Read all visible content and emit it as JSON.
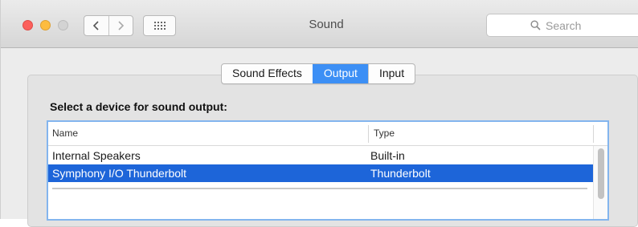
{
  "window": {
    "title": "Sound",
    "search_placeholder": "Search"
  },
  "tabs": [
    {
      "label": "Sound Effects",
      "active": false
    },
    {
      "label": "Output",
      "active": true
    },
    {
      "label": "Input",
      "active": false
    }
  ],
  "output": {
    "section_label": "Select a device for sound output:",
    "columns": {
      "name": "Name",
      "type": "Type"
    },
    "devices": [
      {
        "name": "Internal Speakers",
        "type": "Built-in",
        "selected": false
      },
      {
        "name": "Symphony I/O Thunderbolt",
        "type": "Thunderbolt",
        "selected": true
      }
    ]
  },
  "colors": {
    "accent": "#3c8ff5",
    "selection": "#1d65d9",
    "close": "#fc605c",
    "minimize": "#fdbc40"
  },
  "icons": [
    "close-icon",
    "minimize-icon",
    "zoom-icon",
    "chevron-left-icon",
    "chevron-right-icon",
    "grid-icon",
    "search-icon"
  ]
}
